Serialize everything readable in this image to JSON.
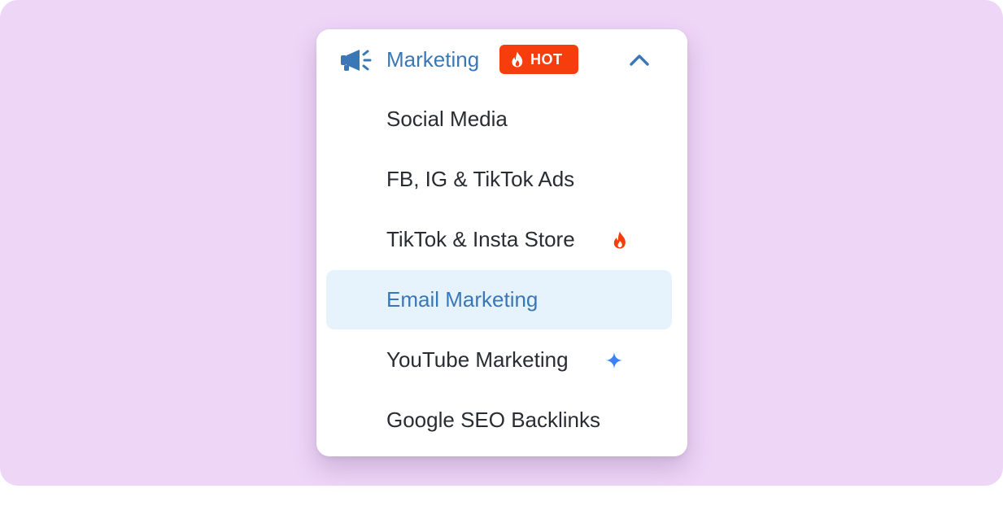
{
  "menu": {
    "header": {
      "label": "Marketing",
      "icon": "megaphone-icon",
      "badge": {
        "label": "HOT",
        "icon": "flame-icon",
        "color": "#f53e0c"
      },
      "toggle_icon": "chevron-up-icon",
      "expanded": true
    },
    "items": [
      {
        "label": "Social Media"
      },
      {
        "label": "FB, IG & TikTok Ads"
      },
      {
        "label": "TikTok & Insta Store",
        "icon": "flame-icon"
      },
      {
        "label": "Email Marketing",
        "active": true
      },
      {
        "label": "YouTube Marketing",
        "icon": "sparkle-icon"
      },
      {
        "label": "Google SEO Backlinks"
      }
    ]
  },
  "colors": {
    "background": "#eed6f7",
    "accent": "#3a77b7",
    "active_row": "#e6f3fc",
    "hot": "#f53e0c",
    "sparkle": "#3b82f6",
    "text": "#2a2c33"
  }
}
